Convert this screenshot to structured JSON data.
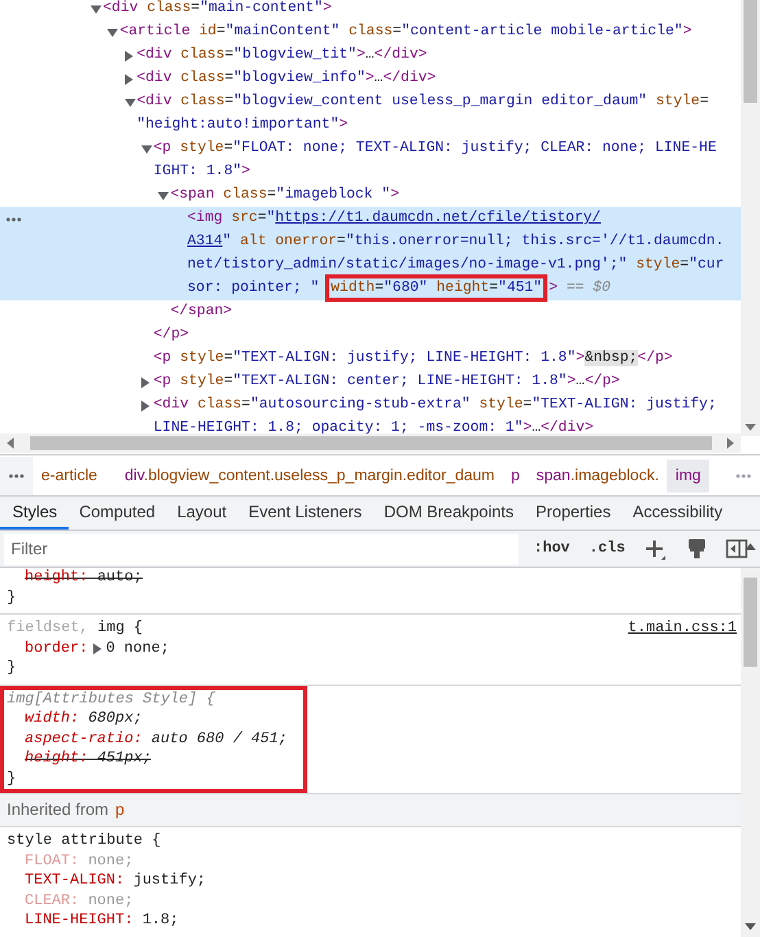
{
  "elements_panel": {
    "nodes": [
      {
        "expanded": true,
        "selected": false,
        "lines": [
          [
            {
              "kind": "tag",
              "text": "<div"
            },
            {
              "kind": "attr",
              "text": " class"
            },
            {
              "kind": "plain",
              "text": "="
            },
            {
              "kind": "value",
              "text": "\"main-content\""
            },
            {
              "kind": "tag",
              "text": ">"
            }
          ]
        ],
        "children": [
          {
            "expanded": true,
            "selected": false,
            "lines": [
              [
                {
                  "kind": "tag",
                  "text": "<article"
                },
                {
                  "kind": "attr",
                  "text": " id"
                },
                {
                  "kind": "plain",
                  "text": "="
                },
                {
                  "kind": "value",
                  "text": "\"mainContent\""
                },
                {
                  "kind": "attr",
                  "text": " class"
                },
                {
                  "kind": "plain",
                  "text": "="
                },
                {
                  "kind": "value",
                  "text": "\"content-article mobile-article\""
                },
                {
                  "kind": "tag",
                  "text": ">"
                }
              ]
            ],
            "children": [
              {
                "expanded": false,
                "selected": false,
                "lines": [
                  [
                    {
                      "kind": "tag",
                      "text": "<div"
                    },
                    {
                      "kind": "attr",
                      "text": " class"
                    },
                    {
                      "kind": "plain",
                      "text": "="
                    },
                    {
                      "kind": "value",
                      "text": "\"blogview_tit\""
                    },
                    {
                      "kind": "tag",
                      "text": ">"
                    },
                    {
                      "kind": "plain",
                      "text": "…"
                    },
                    {
                      "kind": "tag",
                      "text": "</div>"
                    }
                  ]
                ]
              },
              {
                "expanded": false,
                "selected": false,
                "lines": [
                  [
                    {
                      "kind": "tag",
                      "text": "<div"
                    },
                    {
                      "kind": "attr",
                      "text": " class"
                    },
                    {
                      "kind": "plain",
                      "text": "="
                    },
                    {
                      "kind": "value",
                      "text": "\"blogview_info\""
                    },
                    {
                      "kind": "tag",
                      "text": ">"
                    },
                    {
                      "kind": "plain",
                      "text": "…"
                    },
                    {
                      "kind": "tag",
                      "text": "</div>"
                    }
                  ]
                ]
              },
              {
                "expanded": true,
                "selected": false,
                "lines": [
                  [
                    {
                      "kind": "tag",
                      "text": "<div"
                    },
                    {
                      "kind": "attr",
                      "text": " class"
                    },
                    {
                      "kind": "plain",
                      "text": "="
                    },
                    {
                      "kind": "value",
                      "text": "\"blogview_content useless_p_margin editor_daum\""
                    },
                    {
                      "kind": "attr",
                      "text": " style"
                    },
                    {
                      "kind": "plain",
                      "text": "="
                    }
                  ],
                  [
                    {
                      "kind": "value",
                      "text": "\"height:auto!important\""
                    },
                    {
                      "kind": "tag",
                      "text": ">"
                    }
                  ]
                ],
                "children": [
                  {
                    "expanded": true,
                    "selected": false,
                    "lines": [
                      [
                        {
                          "kind": "tag",
                          "text": "<p"
                        },
                        {
                          "kind": "attr",
                          "text": " style"
                        },
                        {
                          "kind": "plain",
                          "text": "="
                        },
                        {
                          "kind": "value",
                          "text": "\"FLOAT: none; TEXT-ALIGN: justify; CLEAR: none; LINE-HE"
                        }
                      ],
                      [
                        {
                          "kind": "value",
                          "text": "IGHT: 1.8\""
                        },
                        {
                          "kind": "tag",
                          "text": ">"
                        }
                      ]
                    ],
                    "children": [
                      {
                        "expanded": true,
                        "selected": false,
                        "lines": [
                          [
                            {
                              "kind": "tag",
                              "text": "<span"
                            },
                            {
                              "kind": "attr",
                              "text": " class"
                            },
                            {
                              "kind": "plain",
                              "text": "="
                            },
                            {
                              "kind": "value",
                              "text": "\"imageblock \""
                            },
                            {
                              "kind": "tag",
                              "text": ">"
                            }
                          ]
                        ],
                        "children": [
                          {
                            "selected": true,
                            "lines": [
                              [
                                {
                                  "kind": "tag",
                                  "text": "<img"
                                },
                                {
                                  "kind": "attr",
                                  "text": " src"
                                },
                                {
                                  "kind": "plain",
                                  "text": "="
                                },
                                {
                                  "kind": "value",
                                  "text": "\""
                                },
                                {
                                  "kind": "link",
                                  "text": "https://t1.daumcdn.net/cfile/tistory/"
                                }
                              ],
                              [
                                {
                                  "kind": "link",
                                  "text": "A314"
                                },
                                {
                                  "kind": "value",
                                  "text": "\""
                                },
                                {
                                  "kind": "attr",
                                  "text": " alt"
                                },
                                {
                                  "kind": "attr",
                                  "text": " onerror"
                                },
                                {
                                  "kind": "plain",
                                  "text": "="
                                },
                                {
                                  "kind": "value",
                                  "text": "\"this.onerror=null; this.src='//t1.daumcdn."
                                }
                              ],
                              [
                                {
                                  "kind": "value",
                                  "text": "net/tistory_admin/static/images/no-image-v1.png';\""
                                },
                                {
                                  "kind": "attr",
                                  "text": " style"
                                },
                                {
                                  "kind": "plain",
                                  "text": "="
                                },
                                {
                                  "kind": "value",
                                  "text": "\"cur"
                                }
                              ],
                              [
                                {
                                  "kind": "value",
                                  "text": "sor: pointer; \" "
                                },
                                {
                                  "annotated": true,
                                  "tokens": [
                                    {
                                      "kind": "attr",
                                      "text": "width"
                                    },
                                    {
                                      "kind": "plain",
                                      "text": "="
                                    },
                                    {
                                      "kind": "value",
                                      "text": "\"680\""
                                    },
                                    {
                                      "kind": "attr",
                                      "text": " height"
                                    },
                                    {
                                      "kind": "plain",
                                      "text": "="
                                    },
                                    {
                                      "kind": "value",
                                      "text": "\"451\""
                                    }
                                  ]
                                },
                                {
                                  "kind": "tag",
                                  "text": ">"
                                },
                                {
                                  "kind": "ref",
                                  "text": " == $0"
                                }
                              ]
                            ]
                          }
                        ],
                        "closing": [
                          [
                            {
                              "kind": "tag",
                              "text": "</span>"
                            }
                          ]
                        ]
                      }
                    ],
                    "closing": [
                      [
                        {
                          "kind": "tag",
                          "text": "</p>"
                        }
                      ]
                    ]
                  },
                  {
                    "selected": false,
                    "lines": [
                      [
                        {
                          "kind": "tag",
                          "text": "<p"
                        },
                        {
                          "kind": "attr",
                          "text": " style"
                        },
                        {
                          "kind": "plain",
                          "text": "="
                        },
                        {
                          "kind": "value",
                          "text": "\"TEXT-ALIGN: justify; LINE-HEIGHT: 1.8\""
                        },
                        {
                          "kind": "tag",
                          "text": ">"
                        },
                        {
                          "kind": "entity",
                          "text": "&nbsp;"
                        },
                        {
                          "kind": "tag",
                          "text": "</p>"
                        }
                      ]
                    ]
                  },
                  {
                    "expanded": false,
                    "selected": false,
                    "lines": [
                      [
                        {
                          "kind": "tag",
                          "text": "<p"
                        },
                        {
                          "kind": "attr",
                          "text": " style"
                        },
                        {
                          "kind": "plain",
                          "text": "="
                        },
                        {
                          "kind": "value",
                          "text": "\"TEXT-ALIGN: center; LINE-HEIGHT: 1.8\""
                        },
                        {
                          "kind": "tag",
                          "text": ">"
                        },
                        {
                          "kind": "plain",
                          "text": "…"
                        },
                        {
                          "kind": "tag",
                          "text": "</p>"
                        }
                      ]
                    ]
                  },
                  {
                    "expanded": false,
                    "selected": false,
                    "lines": [
                      [
                        {
                          "kind": "tag",
                          "text": "<div"
                        },
                        {
                          "kind": "attr",
                          "text": " class"
                        },
                        {
                          "kind": "plain",
                          "text": "="
                        },
                        {
                          "kind": "value",
                          "text": "\"autosourcing-stub-extra\""
                        },
                        {
                          "kind": "attr",
                          "text": " style"
                        },
                        {
                          "kind": "plain",
                          "text": "="
                        },
                        {
                          "kind": "value",
                          "text": "\"TEXT-ALIGN: justify;"
                        }
                      ],
                      [
                        {
                          "kind": "value",
                          "text": "LINE-HEIGHT: 1.8; opacity: 1; -ms-zoom: 1\""
                        },
                        {
                          "kind": "tag",
                          "text": ">"
                        },
                        {
                          "kind": "plain",
                          "text": "…"
                        },
                        {
                          "kind": "tag",
                          "text": "</div>"
                        }
                      ]
                    ]
                  }
                ]
              }
            ]
          }
        ]
      }
    ]
  },
  "breadcrumbs": [
    {
      "classes": "e-article",
      "selected": false
    },
    {
      "tag": "div",
      "classes": ".blogview_content.useless_p_margin.editor_daum",
      "selected": false
    },
    {
      "tag": "p",
      "selected": false
    },
    {
      "tag": "span",
      "classes": ".imageblock.",
      "selected": false
    },
    {
      "tag": "img",
      "selected": true
    }
  ],
  "tabs": [
    {
      "label": "Styles",
      "selected": true
    },
    {
      "label": "Computed",
      "selected": false
    },
    {
      "label": "Layout",
      "selected": false
    },
    {
      "label": "Event Listeners",
      "selected": false
    },
    {
      "label": "DOM Breakpoints",
      "selected": false
    },
    {
      "label": "Properties",
      "selected": false
    },
    {
      "label": "Accessibility",
      "selected": false
    }
  ],
  "filter": {
    "placeholder": "Filter"
  },
  "toolbar": {
    "hover_toggle": ":hov",
    "class_toggle": ".cls"
  },
  "styles": [
    {
      "kind": "rule",
      "attribute_style": false,
      "annotated": false,
      "declarations": [
        {
          "property": "height:",
          "value": " auto;",
          "overridden": true,
          "inactive": false
        }
      ],
      "closing": "}"
    },
    {
      "kind": "rule",
      "attribute_style": false,
      "annotated": false,
      "selector": [
        {
          "text": "fieldset, ",
          "matched": false
        },
        {
          "text": "img",
          "matched": true
        },
        {
          "text": " {",
          "matched": true
        }
      ],
      "source": "t.main.css:1",
      "declarations": [
        {
          "property": "border:",
          "value": "0 none;",
          "overridden": false,
          "inactive": false,
          "expanded": false
        }
      ],
      "closing": "}"
    },
    {
      "kind": "rule",
      "attribute_style": true,
      "annotated": true,
      "selector": [
        {
          "text": "img[Attributes Style] {",
          "matched": true
        }
      ],
      "declarations": [
        {
          "property": "width:",
          "value": " 680px;",
          "overridden": false,
          "inactive": false
        },
        {
          "property": "aspect-ratio:",
          "value": " auto 680 / 451;",
          "overridden": false,
          "inactive": false
        },
        {
          "property": "height:",
          "value": " 451px;",
          "overridden": true,
          "inactive": false
        }
      ],
      "closing": "}"
    },
    {
      "kind": "inherited",
      "label": "Inherited from",
      "element": "p"
    },
    {
      "kind": "rule",
      "attribute_style": false,
      "annotated": false,
      "selector": [
        {
          "text": "style attribute {",
          "matched": true
        }
      ],
      "declarations": [
        {
          "property": "FLOAT:",
          "value": " none;",
          "overridden": false,
          "inactive": true
        },
        {
          "property": "TEXT-ALIGN:",
          "value": " justify;",
          "overridden": false,
          "inactive": false
        },
        {
          "property": "CLEAR:",
          "value": " none;",
          "overridden": false,
          "inactive": true
        },
        {
          "property": "LINE-HEIGHT:",
          "value": " 1.8;",
          "overridden": false,
          "inactive": false
        }
      ]
    }
  ]
}
